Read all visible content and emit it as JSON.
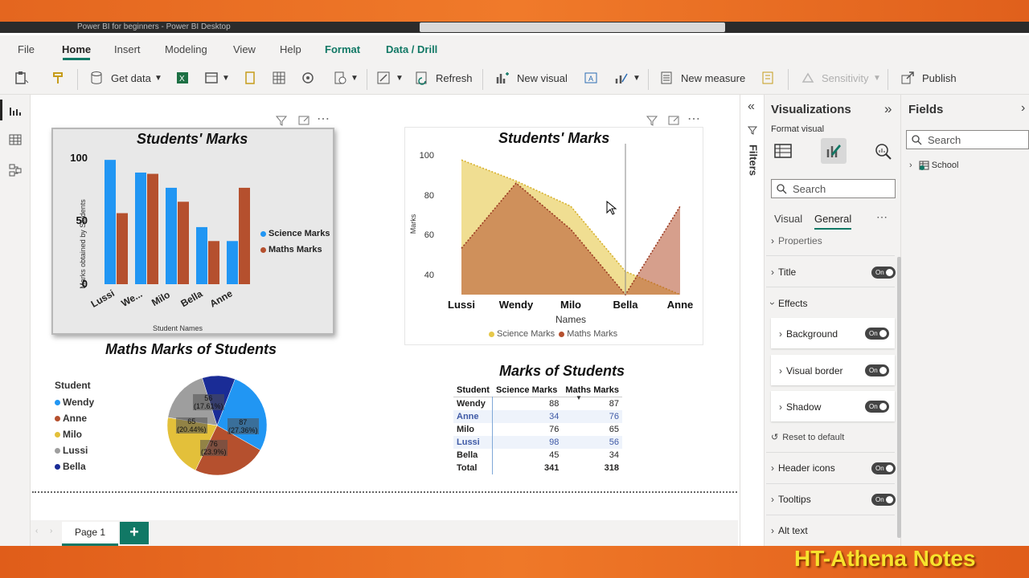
{
  "window": {
    "title": "Power BI for beginners - Power BI Desktop"
  },
  "menu": {
    "file": "File",
    "home": "Home",
    "insert": "Insert",
    "modeling": "Modeling",
    "view": "View",
    "help": "Help",
    "format": "Format",
    "data_drill": "Data / Drill"
  },
  "ribbon": {
    "get_data": "Get data",
    "refresh": "Refresh",
    "new_visual": "New visual",
    "new_measure": "New measure",
    "sensitivity": "Sensitivity",
    "publish": "Publish"
  },
  "bar_chart": {
    "title": "Students' Marks",
    "ylabel": "Marks obtained by Students",
    "xlabel": "Student Names",
    "yticks": [
      "100",
      "50",
      "0"
    ],
    "categories": [
      "Lussi",
      "We...",
      "Milo",
      "Bella",
      "Anne"
    ],
    "legend": [
      "Science Marks",
      "Maths Marks"
    ]
  },
  "area_chart": {
    "title": "Students' Marks",
    "ylabel": "Marks",
    "xlabel": "Names",
    "yticks": [
      "100",
      "80",
      "60",
      "40"
    ],
    "categories": [
      "Lussi",
      "Wendy",
      "Milo",
      "Bella",
      "Anne"
    ],
    "legend": [
      "Science Marks",
      "Maths Marks"
    ]
  },
  "pie_chart": {
    "title": "Maths Marks of Students",
    "legend_title": "Student",
    "legend": [
      "Wendy",
      "Anne",
      "Milo",
      "Lussi",
      "Bella"
    ],
    "labels": [
      {
        "value": "87",
        "pct": "(27.36%)"
      },
      {
        "value": "76",
        "pct": "(23.9%)"
      },
      {
        "value": "65",
        "pct": "(20.44%)"
      },
      {
        "value": "56",
        "pct": "(17.61%)"
      }
    ]
  },
  "table": {
    "title": "Marks of Students",
    "headers": [
      "Student",
      "Science Marks",
      "Maths Marks"
    ],
    "rows": [
      [
        "Wendy",
        "88",
        "87"
      ],
      [
        "Anne",
        "34",
        "76"
      ],
      [
        "Milo",
        "76",
        "65"
      ],
      [
        "Lussi",
        "98",
        "56"
      ],
      [
        "Bella",
        "45",
        "34"
      ]
    ],
    "total": [
      "Total",
      "341",
      "318"
    ]
  },
  "chart_data": [
    {
      "type": "bar",
      "title": "Students' Marks",
      "xlabel": "Student Names",
      "ylabel": "Marks obtained by Students",
      "categories": [
        "Lussi",
        "Wendy",
        "Milo",
        "Bella",
        "Anne"
      ],
      "series": [
        {
          "name": "Science Marks",
          "values": [
            98,
            88,
            76,
            45,
            34
          ],
          "color": "#2196f3"
        },
        {
          "name": "Maths Marks",
          "values": [
            56,
            87,
            65,
            34,
            76
          ],
          "color": "#b5502e"
        }
      ],
      "ylim": [
        0,
        100
      ],
      "legend_position": "right"
    },
    {
      "type": "area",
      "title": "Students' Marks",
      "xlabel": "Names",
      "ylabel": "Marks",
      "categories": [
        "Lussi",
        "Wendy",
        "Milo",
        "Bella",
        "Anne"
      ],
      "series": [
        {
          "name": "Science Marks",
          "values": [
            98,
            88,
            76,
            45,
            34
          ],
          "color": "#e6c84a"
        },
        {
          "name": "Maths Marks",
          "values": [
            56,
            87,
            65,
            34,
            76
          ],
          "color": "#b5502e"
        }
      ],
      "ylim": [
        34,
        100
      ],
      "legend_position": "bottom"
    },
    {
      "type": "pie",
      "title": "Maths Marks of Students",
      "categories": [
        "Wendy",
        "Anne",
        "Milo",
        "Lussi",
        "Bella"
      ],
      "values": [
        87,
        76,
        65,
        56,
        34
      ],
      "colors": [
        "#2196f3",
        "#b5502e",
        "#e3c03a",
        "#9e9e9e",
        "#1a2c96"
      ],
      "legend_position": "left"
    },
    {
      "type": "table",
      "title": "Marks of Students",
      "columns": [
        "Student",
        "Science Marks",
        "Maths Marks"
      ],
      "rows": [
        [
          "Wendy",
          88,
          87
        ],
        [
          "Anne",
          34,
          76
        ],
        [
          "Milo",
          76,
          65
        ],
        [
          "Lussi",
          98,
          56
        ],
        [
          "Bella",
          45,
          34
        ]
      ],
      "total": [
        "Total",
        341,
        318
      ]
    }
  ],
  "filters_pane": {
    "label": "Filters"
  },
  "viz_pane": {
    "title": "Visualizations",
    "format_visual": "Format visual",
    "search_placeholder": "Search",
    "tab_visual": "Visual",
    "tab_general": "General",
    "properties": "Properties",
    "title_row": "Title",
    "effects": "Effects",
    "background": "Background",
    "visual_border": "Visual border",
    "shadow": "Shadow",
    "reset": "Reset to default",
    "header_icons": "Header icons",
    "tooltips": "Tooltips",
    "alt_text": "Alt text",
    "toggle_on": "On"
  },
  "fields_pane": {
    "title": "Fields",
    "search_placeholder": "Search",
    "table_name": "School"
  },
  "pages": {
    "page1": "Page 1",
    "add": "+"
  },
  "watermark": "HT-Athena Notes",
  "colors": {
    "accent": "#117865",
    "frame": "#ec6f24",
    "watermark": "#f7e22c"
  }
}
